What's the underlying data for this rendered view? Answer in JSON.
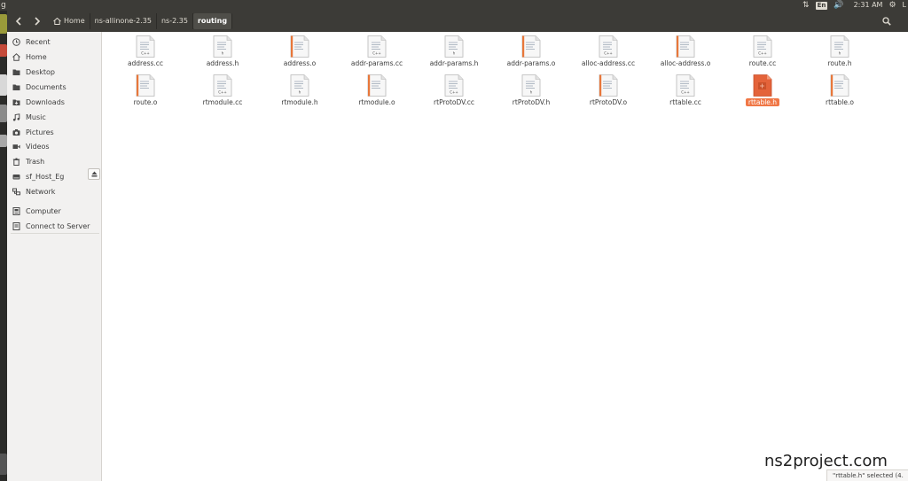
{
  "top_panel": {
    "app_letter": "g",
    "keyboard": "En",
    "time": "2:31 AM",
    "user_initial": "L",
    "icons": [
      "network-updown-icon",
      "volume-icon",
      "gear-icon"
    ]
  },
  "toolbar": {
    "breadcrumbs": [
      "Home",
      "ns-allinone-2.35",
      "ns-2.35",
      "routing"
    ],
    "icons": [
      "back-arrow-icon",
      "forward-arrow-icon",
      "home-icon",
      "search-icon"
    ]
  },
  "sidebar": {
    "places": [
      {
        "label": "Recent",
        "icon": "clock-icon"
      },
      {
        "label": "Home",
        "icon": "home-icon"
      },
      {
        "label": "Desktop",
        "icon": "folder-icon"
      },
      {
        "label": "Documents",
        "icon": "folder-icon"
      },
      {
        "label": "Downloads",
        "icon": "download-icon"
      },
      {
        "label": "Music",
        "icon": "music-icon"
      },
      {
        "label": "Pictures",
        "icon": "camera-icon"
      },
      {
        "label": "Videos",
        "icon": "video-icon"
      },
      {
        "label": "Trash",
        "icon": "trash-icon"
      },
      {
        "label": "sf_Host_Eg",
        "icon": "drive-icon"
      },
      {
        "label": "Network",
        "icon": "network-icon"
      }
    ],
    "devices": [
      {
        "label": "Computer",
        "icon": "computer-icon"
      },
      {
        "label": "Connect to Server",
        "icon": "server-icon"
      }
    ]
  },
  "files": [
    {
      "name": "address.cc",
      "type": "cpp"
    },
    {
      "name": "address.h",
      "type": "header"
    },
    {
      "name": "address.o",
      "type": "object"
    },
    {
      "name": "addr-params.cc",
      "type": "cpp"
    },
    {
      "name": "addr-params.h",
      "type": "header"
    },
    {
      "name": "addr-params.o",
      "type": "object"
    },
    {
      "name": "alloc-address.cc",
      "type": "cpp"
    },
    {
      "name": "alloc-address.o",
      "type": "object"
    },
    {
      "name": "route.cc",
      "type": "cpp"
    },
    {
      "name": "route.h",
      "type": "header"
    },
    {
      "name": "route.o",
      "type": "object"
    },
    {
      "name": "rtmodule.cc",
      "type": "cpp"
    },
    {
      "name": "rtmodule.h",
      "type": "header"
    },
    {
      "name": "rtmodule.o",
      "type": "object"
    },
    {
      "name": "rtProtoDV.cc",
      "type": "cpp"
    },
    {
      "name": "rtProtoDV.h",
      "type": "header"
    },
    {
      "name": "rtProtoDV.o",
      "type": "object"
    },
    {
      "name": "rttable.cc",
      "type": "cpp"
    },
    {
      "name": "rttable.h",
      "type": "header",
      "selected": true
    },
    {
      "name": "rttable.o",
      "type": "object"
    }
  ],
  "status": "\"rttable.h\" selected  (4.",
  "watermark": "ns2project.com",
  "colors": {
    "panel": "#3c3b37",
    "sidebar": "#f2f1f0",
    "selection": "#f07746",
    "object_stripe": "#e8773a"
  }
}
